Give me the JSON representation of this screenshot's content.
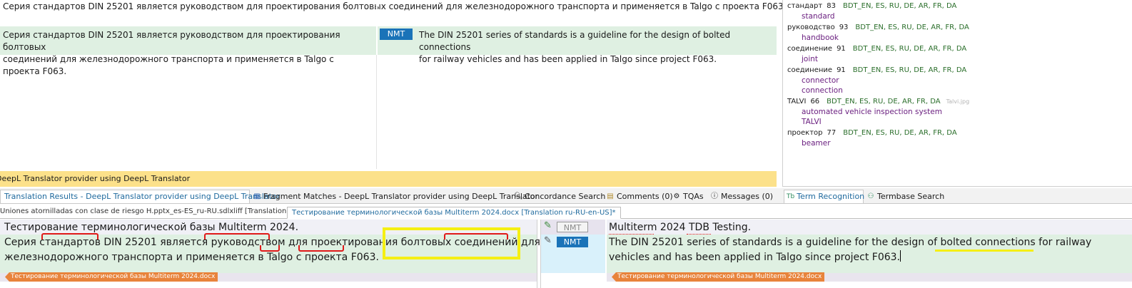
{
  "results": {
    "source_line": "Серия стандартов DIN 25201 является руководством для проектирования болтовых соединений для железнодорожного транспорта и применяется в Talgo с проекта F063.",
    "source_l1": "Серия стандартов DIN 25201 является руководством для проектирования болтовых",
    "source_l2": "соединений для железнодорожного транспорта и применяется в Talgo с проекта F063.",
    "badge": "NMT",
    "target_l1": "The DIN 25201 series of standards is a guideline for the design of bolted connections",
    "target_l2": "for railway vehicles and has been applied in Talgo since project F063.",
    "provider_bar": "DeepL Translator provider using DeepL Translator"
  },
  "terms": [
    {
      "term": "стандарт",
      "score": "83",
      "tb": "BDT_EN, ES, RU, DE, AR, FR, DA",
      "translations": [
        "standard"
      ]
    },
    {
      "term": "руководство",
      "score": "93",
      "tb": "BDT_EN, ES, RU, DE, AR, FR, DA",
      "translations": [
        "handbook"
      ]
    },
    {
      "term": "соединение",
      "score": "91",
      "tb": "BDT_EN, ES, RU, DE, AR, FR, DA",
      "translations": [
        "joint"
      ]
    },
    {
      "term": "соединение",
      "score": "91",
      "tb": "BDT_EN, ES, RU, DE, AR, FR, DA",
      "translations": [
        "connector",
        "connection"
      ]
    },
    {
      "term": "TALVI",
      "score": "66",
      "tb": "BDT_EN, ES, RU, DE, AR, FR, DA",
      "image": "Talvi.jpg",
      "translations": [
        "automated vehicle inspection system",
        "TALVI"
      ]
    },
    {
      "term": "проектор",
      "score": "77",
      "tb": "BDT_EN, ES, RU, DE, AR, FR, DA",
      "translations": [
        "beamer"
      ]
    }
  ],
  "tabs": {
    "results": "Translation Results - DeepL Translator provider using DeepL Translator",
    "fragment": "Fragment Matches - DeepL Translator provider using DeepL Translator",
    "concordance": "Concordance Search",
    "comments": "Comments (0)",
    "tqas": "TQAs",
    "messages": "Messages (0)",
    "term_recognition": "Term Recognition",
    "termbase_search": "Termbase Search"
  },
  "doc_tabs": {
    "tab1": "Uniones atornilladas con clase de riesgo H.pptx_es-ES_ru-RU.sdlxliff [Translation]",
    "tab2": "Тестирование терминологической базы Multiterm 2024.docx [Translation ru-RU-en-US]*"
  },
  "editor": {
    "seg1_source": "Тестирование терминологической базы Multiterm 2024.",
    "seg1_status": "NMT",
    "seg1_target": "Multiterm 2024 TDB Testing.",
    "seg2_source_l1": "Серия стандартов DIN 25201 является руководством для проектирования болтовых соединений для",
    "seg2_source_l2": "железнодорожного транспорта и применяется в Talgo с проекта F063.",
    "seg2_status": "NMT",
    "seg2_target_l1": "The DIN 25201 series of standards is a guideline for the design of bolted connections for railway",
    "seg2_target_l2": "vehicles and has been applied in Talgo since project F063.",
    "context_tag": "Тестирование терминологической базы Multiterm 2024.docx"
  },
  "colors": {
    "match_green": "#dff0e2",
    "provider_yellow": "#fce18a",
    "nmt_blue": "#1a73b8",
    "term_purple": "#6b2080",
    "termbase_green": "#2a6e2a",
    "context_orange": "#e8833b",
    "highlight_yellow": "#f5ef14",
    "underline_red": "#e01919"
  }
}
